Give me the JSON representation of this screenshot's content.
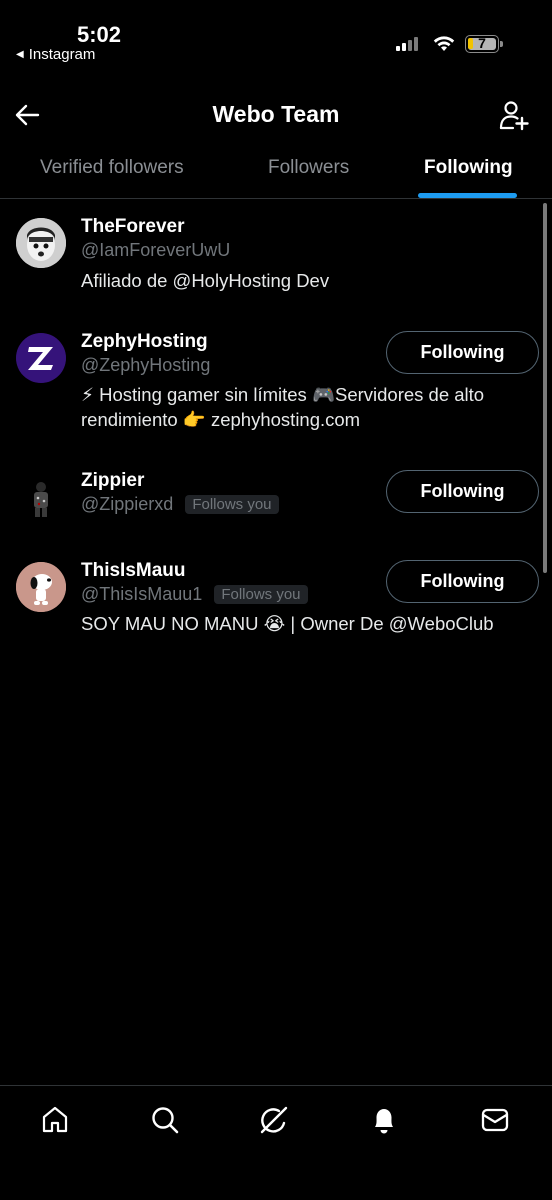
{
  "status_bar": {
    "time": "5:02",
    "back_app_label": "Instagram",
    "battery_level": "7",
    "battery_color": "#f2c300"
  },
  "header": {
    "title": "Webo Team",
    "back_icon": "arrow-left-icon",
    "add_icon": "add-user-icon"
  },
  "tabs": [
    {
      "label": "Verified followers",
      "active": false
    },
    {
      "label": "Followers",
      "active": false
    },
    {
      "label": "Following",
      "active": true
    }
  ],
  "accent_color": "#1d9bf0",
  "users": [
    {
      "name": "TheForever",
      "handle": "@IamForeverUwU",
      "bio": "Afiliado de @HolyHosting Dev",
      "follows_you": false,
      "button": null
    },
    {
      "name": "ZephyHosting",
      "handle": "@ZephyHosting",
      "bio": "⚡ Hosting gamer sin límites 🎮Servidores de alto rendimiento 👉 zephyhosting.com",
      "follows_you": false,
      "button": "Following"
    },
    {
      "name": "Zippier",
      "handle": "@Zippierxd",
      "badge": "Follows you",
      "bio": "",
      "follows_you": true,
      "button": "Following"
    },
    {
      "name": "ThisIsMauu",
      "handle": "@ThisIsMauu1",
      "badge": "Follows you",
      "bio": "SOY MAU NO MANU 😭 | Owner De @WeboClub",
      "follows_you": true,
      "button": "Following"
    }
  ],
  "bottom_nav": [
    {
      "icon": "home-icon"
    },
    {
      "icon": "search-icon"
    },
    {
      "icon": "grok-icon"
    },
    {
      "icon": "notifications-icon"
    },
    {
      "icon": "messages-icon"
    }
  ]
}
